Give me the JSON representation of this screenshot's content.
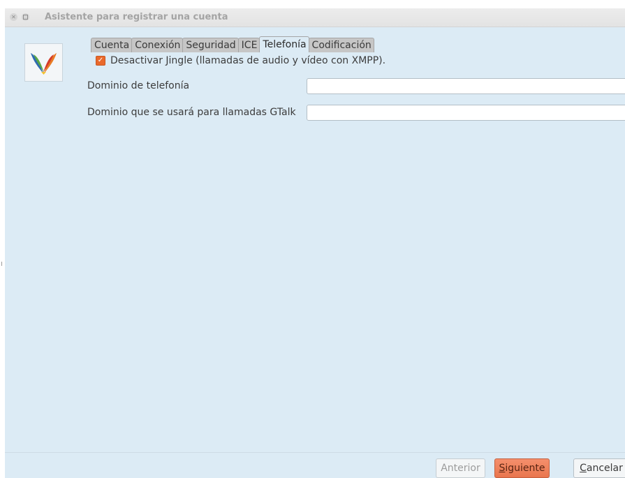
{
  "window": {
    "title": "Asistente para registrar una cuenta"
  },
  "tabs": [
    {
      "label": "Cuenta",
      "active": false
    },
    {
      "label": "Conexión",
      "active": false
    },
    {
      "label": "Seguridad",
      "active": false
    },
    {
      "label": "ICE",
      "active": false
    },
    {
      "label": "Telefonía",
      "active": true
    },
    {
      "label": "Codificación",
      "active": false
    }
  ],
  "telephony": {
    "disable_jingle": {
      "label": "Desactivar Jingle (llamadas de audio y vídeo con XMPP).",
      "checked": true
    },
    "phone_domain": {
      "label": "Dominio de telefonía",
      "value": ""
    },
    "gtalk_domain": {
      "label": "Dominio que se usará para llamadas GTalk",
      "value": ""
    }
  },
  "buttons": {
    "previous": {
      "label": "Anterior",
      "enabled": false
    },
    "next": {
      "label_mnemonic": "S",
      "label_rest": "iguiente",
      "enabled": true
    },
    "cancel": {
      "label_mnemonic": "C",
      "label_rest": "ancelar",
      "enabled": true
    }
  },
  "colors": {
    "accent": "#e9692c",
    "background": "#dcebf5",
    "next_button": "#f08560"
  },
  "icons": {
    "app_logo": "jitsi-logo",
    "close": "close-icon",
    "maximize": "maximize-icon"
  }
}
